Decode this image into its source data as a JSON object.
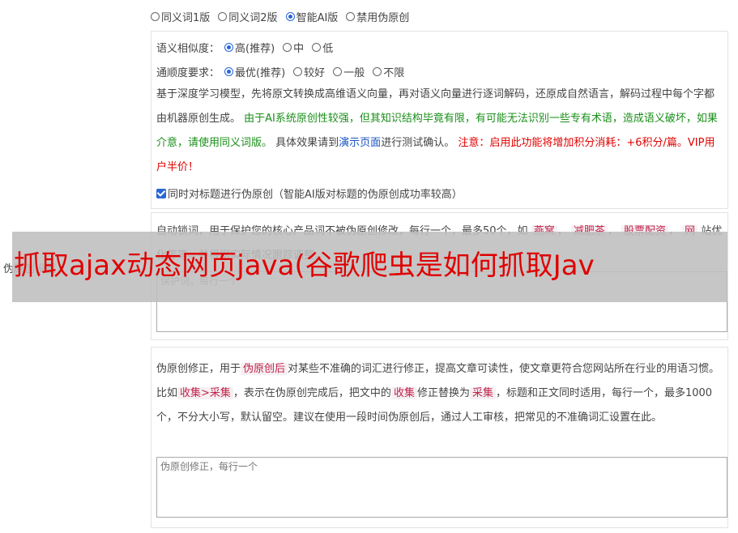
{
  "version_options": {
    "items": [
      "同义词1版",
      "同义词2版",
      "智能AI版",
      "禁用伪原创"
    ],
    "selected": 2
  },
  "similarity": {
    "label": "语义相似度：",
    "options": [
      "高(推荐)",
      "中",
      "低"
    ],
    "selected": 0
  },
  "fluency": {
    "label": "通顺度要求：",
    "options": [
      "最优(推荐)",
      "较好",
      "一般",
      "不限"
    ],
    "selected": 0
  },
  "description": {
    "p1": "基于深度学习模型，先将原文转换成高维语义向量，再对语义向量进行逐词解码，还原成自然语言，解码过程中每个字都由机器原创生成。",
    "p2_green": "由于AI系统原创性较强，但其知识结构毕竟有限，有可能无法识别一些专有术语，造成语义破坏，如果介意，请使用同义词版。",
    "p3": "具体效果请到",
    "demo_link": "演示页面",
    "p4": "进行测试确认。",
    "notice_red": "注意：启用此功能将增加积分消耗：+6积分/篇。VIP用户半价！"
  },
  "title_checkbox": {
    "label": "同时对标题进行伪原创（智能AI版对标题的伪原创成功率较高）",
    "checked": true
  },
  "lock_words": {
    "text_before": "自动锁词，用于保护您的核心产品词不被伪原创修改，每行一个，最多50个，如",
    "examples": [
      "燕窝",
      "减肥茶",
      "股票配资",
      "网"
    ],
    "line2": "站优化等等。并根据实际情况跟踪调整。",
    "placeholder": "保护词，每行一个"
  },
  "side_label": "伪原创设置",
  "overlay_title": "抓取ajax动态网页java(谷歌爬虫是如何抓取Jav",
  "correction": {
    "t1": "伪原创修正，用于",
    "tag1": "伪原创后",
    "t2": "对某些不准确的词汇进行修正，提高文章可读性，使文章更符合您网站所在行业的用语习惯。比如",
    "tag2": "收集>采集",
    "t3": "，表示在伪原创完成后，把文中的",
    "tag3": "收集",
    "t4": "修正替换为",
    "tag4": "采集",
    "t5": "，标题和正文同时适用，每行一个，最多1000个，不分大小写，默认留空。建议在使用一段时间伪原创后，通过人工审核，把常见的不准确词汇设置在此。",
    "placeholder": "伪原创修正，每行一个"
  }
}
